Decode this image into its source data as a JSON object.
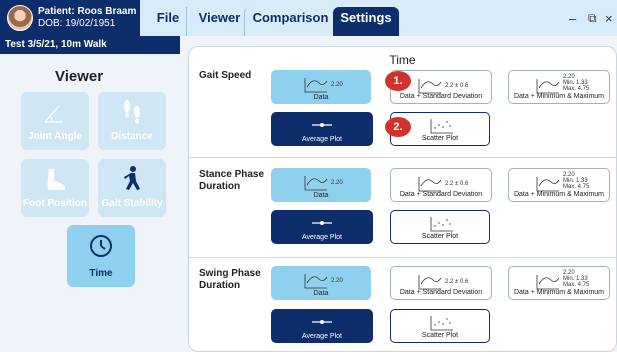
{
  "header": {
    "patient_name": "Patient: Roos Braam",
    "patient_dob": "DOB: 19/02/1951",
    "test_label": "Test 3/5/21, 10m Walk",
    "tabs": [
      {
        "label": "File"
      },
      {
        "label": "Viewer"
      },
      {
        "label": "Comparison"
      },
      {
        "label": "Settings",
        "active": true
      }
    ],
    "window_controls": {
      "minimize": "–",
      "maximize": "⧉",
      "close": "×"
    }
  },
  "sidebar": {
    "title": "Viewer",
    "items": [
      {
        "label": "Joint Angle",
        "icon": "angle-icon"
      },
      {
        "label": "Distance",
        "icon": "footsteps-icon"
      },
      {
        "label": "Foot Position",
        "icon": "foot-icon"
      },
      {
        "label": "Gait Stability",
        "icon": "walking-person-icon"
      },
      {
        "label": "Time",
        "icon": "clock-icon",
        "active": true
      }
    ]
  },
  "main": {
    "title": "Time",
    "rows": [
      {
        "label": "Gait Speed"
      },
      {
        "label": "Stance Phase Duration"
      },
      {
        "label": "Swing Phase Duration"
      }
    ],
    "options": {
      "data": {
        "label": "Data",
        "value": "2.20"
      },
      "data_sd": {
        "label": "Data + Standard Deviation",
        "value": "2.2 ± 0.6"
      },
      "data_minmax": {
        "label": "Data + Minimum & Maximum",
        "value": "2.20",
        "min": "Min. 1.33",
        "max": "Max. 4.75"
      },
      "average": {
        "label": "Average Plot"
      },
      "scatter": {
        "label": "Scatter Plot"
      }
    },
    "badges": [
      "1.",
      "2."
    ]
  },
  "colors": {
    "navy": "#0e2d6b",
    "light_blue": "#8fd0ee",
    "badge_red": "#d2322c"
  }
}
